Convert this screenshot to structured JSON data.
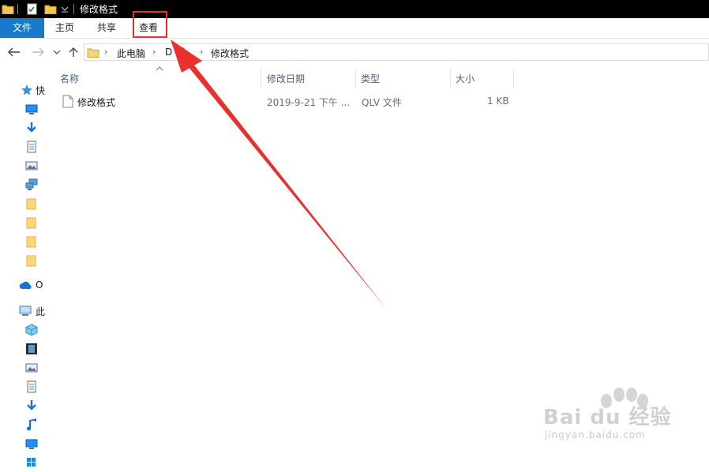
{
  "window": {
    "title": "修改格式"
  },
  "ribbon": {
    "tabs": [
      {
        "label": "文件"
      },
      {
        "label": "主页"
      },
      {
        "label": "共享"
      },
      {
        "label": "查看"
      }
    ]
  },
  "address": {
    "crumbs": [
      "此电脑",
      "D",
      ":)",
      "修改格式"
    ]
  },
  "columns": {
    "name": "名称",
    "date": "修改日期",
    "type": "类型",
    "size": "大小"
  },
  "files": [
    {
      "name": "修改格式",
      "date": "2019-9-21 下午 ...",
      "type": "QLV 文件",
      "size": "1 KB"
    }
  ],
  "nav_pane": {
    "quick_access_label": "快",
    "onedrive_label": "O",
    "this_pc_label": "此"
  },
  "watermark": {
    "brand": "Bai du 经验",
    "url": "jingyan.baidu.com"
  },
  "colors": {
    "file_tab_bg": "#1979ca",
    "highlight": "#e8302f",
    "arrow": "#e8302f"
  }
}
